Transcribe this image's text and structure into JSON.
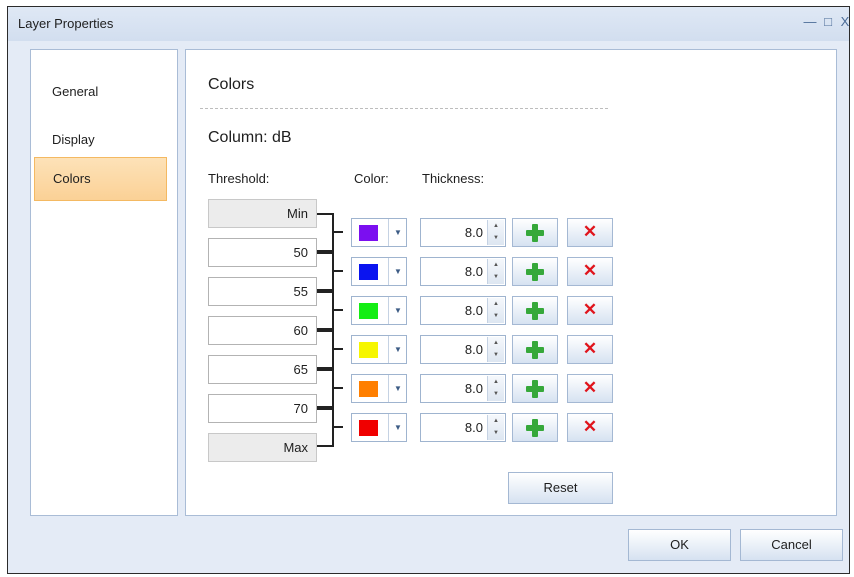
{
  "window": {
    "title": "Layer Properties",
    "minimize_glyph": "—",
    "maximize_glyph": "□",
    "close_glyph": "X"
  },
  "sidebar": {
    "items": [
      {
        "label": "General",
        "active": false
      },
      {
        "label": "Display",
        "active": false
      },
      {
        "label": "Colors",
        "active": true
      }
    ]
  },
  "colors": {
    "heading": "Colors",
    "column_label": "Column: dB",
    "headers": {
      "threshold": "Threshold:",
      "color": "Color:",
      "thickness": "Thickness:"
    },
    "thresholds": [
      "Min",
      "50",
      "55",
      "60",
      "65",
      "70",
      "Max"
    ],
    "rows": [
      {
        "color": "#7b0ff0",
        "thickness": "8.0"
      },
      {
        "color": "#0a14f0",
        "thickness": "8.0"
      },
      {
        "color": "#14ee14",
        "thickness": "8.0"
      },
      {
        "color": "#f6f600",
        "thickness": "8.0"
      },
      {
        "color": "#ff7f00",
        "thickness": "8.0"
      },
      {
        "color": "#f00000",
        "thickness": "8.0"
      }
    ],
    "reset_label": "Reset"
  },
  "footer": {
    "ok_label": "OK",
    "cancel_label": "Cancel"
  }
}
